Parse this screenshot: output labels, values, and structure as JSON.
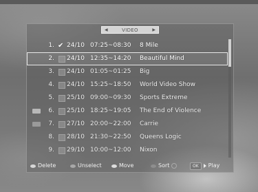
{
  "header": {
    "title": "VIDEO",
    "left_arrow": "◀",
    "right_arrow": "▶"
  },
  "rows": [
    {
      "num": "1.",
      "checked": true,
      "date": "24/10",
      "time": "07:25~08:30",
      "title": "8 Mile"
    },
    {
      "num": "2.",
      "checked": false,
      "date": "24/10",
      "time": "12:35~14:20",
      "title": "Beautiful Mind"
    },
    {
      "num": "3.",
      "checked": false,
      "date": "24/10",
      "time": "01:05~01:25",
      "title": "Big"
    },
    {
      "num": "4.",
      "checked": false,
      "date": "24/10",
      "time": "15:25~18:50",
      "title": "World Video Show"
    },
    {
      "num": "5.",
      "checked": false,
      "date": "25/10",
      "time": "09:00~09:30",
      "title": "Sports Extreme"
    },
    {
      "num": "6.",
      "checked": false,
      "date": "25/10",
      "time": "18:25~19:05",
      "title": "The End of Violence"
    },
    {
      "num": "7.",
      "checked": false,
      "date": "27/10",
      "time": "20:00~22:00",
      "title": "Carrie"
    },
    {
      "num": "8.",
      "checked": false,
      "date": "28/10",
      "time": "21:30~22:50",
      "title": "Queens Logic"
    },
    {
      "num": "9.",
      "checked": false,
      "date": "29/10",
      "time": "10:00~12:00",
      "title": "Nixon"
    }
  ],
  "highlighted_row": 2,
  "footer": {
    "delete": "Delete",
    "unselect": "Unselect",
    "move": "Move",
    "sort": "Sort",
    "ok": "OK",
    "play": "Play"
  }
}
